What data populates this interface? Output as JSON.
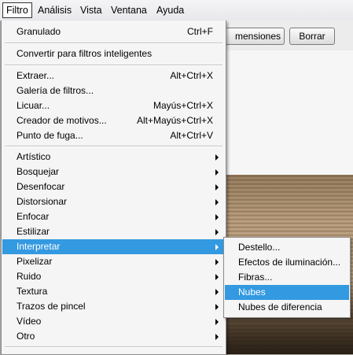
{
  "menubar": {
    "items": [
      "Filtro",
      "Análisis",
      "Vista",
      "Ventana",
      "Ayuda"
    ]
  },
  "options_bar": {
    "dimensions_button": "mensiones",
    "clear_button": "Borrar"
  },
  "filter_menu": {
    "granulado": {
      "label": "Granulado",
      "shortcut": "Ctrl+F"
    },
    "convertir": {
      "label": "Convertir para filtros inteligentes"
    },
    "extraer": {
      "label": "Extraer...",
      "shortcut": "Alt+Ctrl+X"
    },
    "galeria": {
      "label": "Galería de filtros..."
    },
    "licuar": {
      "label": "Licuar...",
      "shortcut": "Mayús+Ctrl+X"
    },
    "creador": {
      "label": "Creador de motivos...",
      "shortcut": "Alt+Mayús+Ctrl+X"
    },
    "punto_fuga": {
      "label": "Punto de fuga...",
      "shortcut": "Alt+Ctrl+V"
    },
    "submenus": [
      "Artístico",
      "Bosquejar",
      "Desenfocar",
      "Distorsionar",
      "Enfocar",
      "Estilizar",
      "Interpretar",
      "Pixelizar",
      "Ruido",
      "Textura",
      "Trazos de pincel",
      "Vídeo",
      "Otro"
    ],
    "highlighted": "Interpretar"
  },
  "interpretar_submenu": {
    "items": [
      "Destello...",
      "Efectos de iluminación...",
      "Fibras...",
      "Nubes",
      "Nubes de diferencia"
    ],
    "highlighted": "Nubes"
  },
  "colors": {
    "highlight": "#3399e0",
    "menu_bg": "#f5f5f5"
  }
}
